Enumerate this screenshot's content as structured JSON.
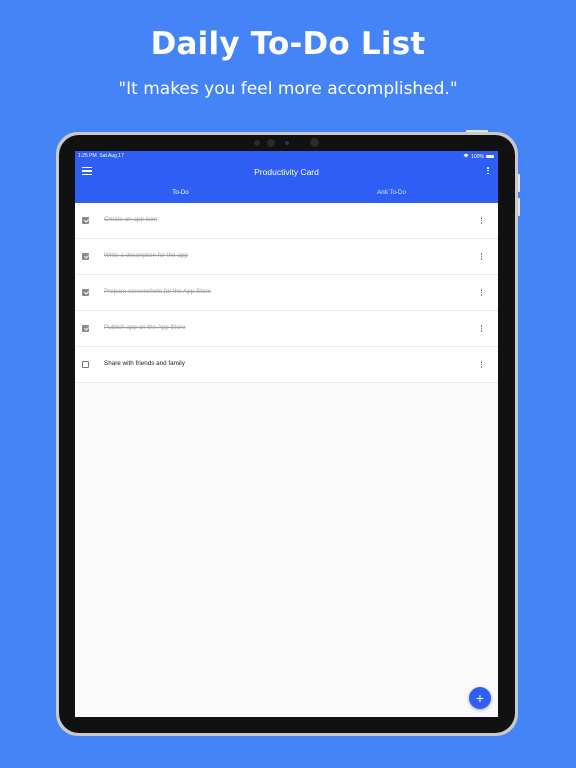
{
  "header": {
    "headline": "Daily To-Do List",
    "tagline": "\"It makes you feel more accomplished.\""
  },
  "statusbar": {
    "time": "1:25 PM",
    "date": "Sat Aug 17",
    "battery": "100%"
  },
  "appbar": {
    "title": "Productivity Card",
    "menu_icon": "hamburger-icon",
    "overflow_icon": "more-vert-icon"
  },
  "tabs": [
    {
      "label": "To-Do",
      "selected": true
    },
    {
      "label": "Anti To-Do",
      "selected": false
    }
  ],
  "tasks": [
    {
      "text": "Create an app icon",
      "done": true
    },
    {
      "text": "Write a description for the app",
      "done": true
    },
    {
      "text": "Prepare screenshots for the App Store",
      "done": true
    },
    {
      "text": "Publish app on the App Store",
      "done": true
    },
    {
      "text": "Share with friends and family",
      "done": false
    }
  ],
  "fab": {
    "label": "+"
  },
  "colors": {
    "background": "#4484f7",
    "primary": "#2f5ef5",
    "text": "#212121",
    "done_text": "#9e9e9e"
  }
}
